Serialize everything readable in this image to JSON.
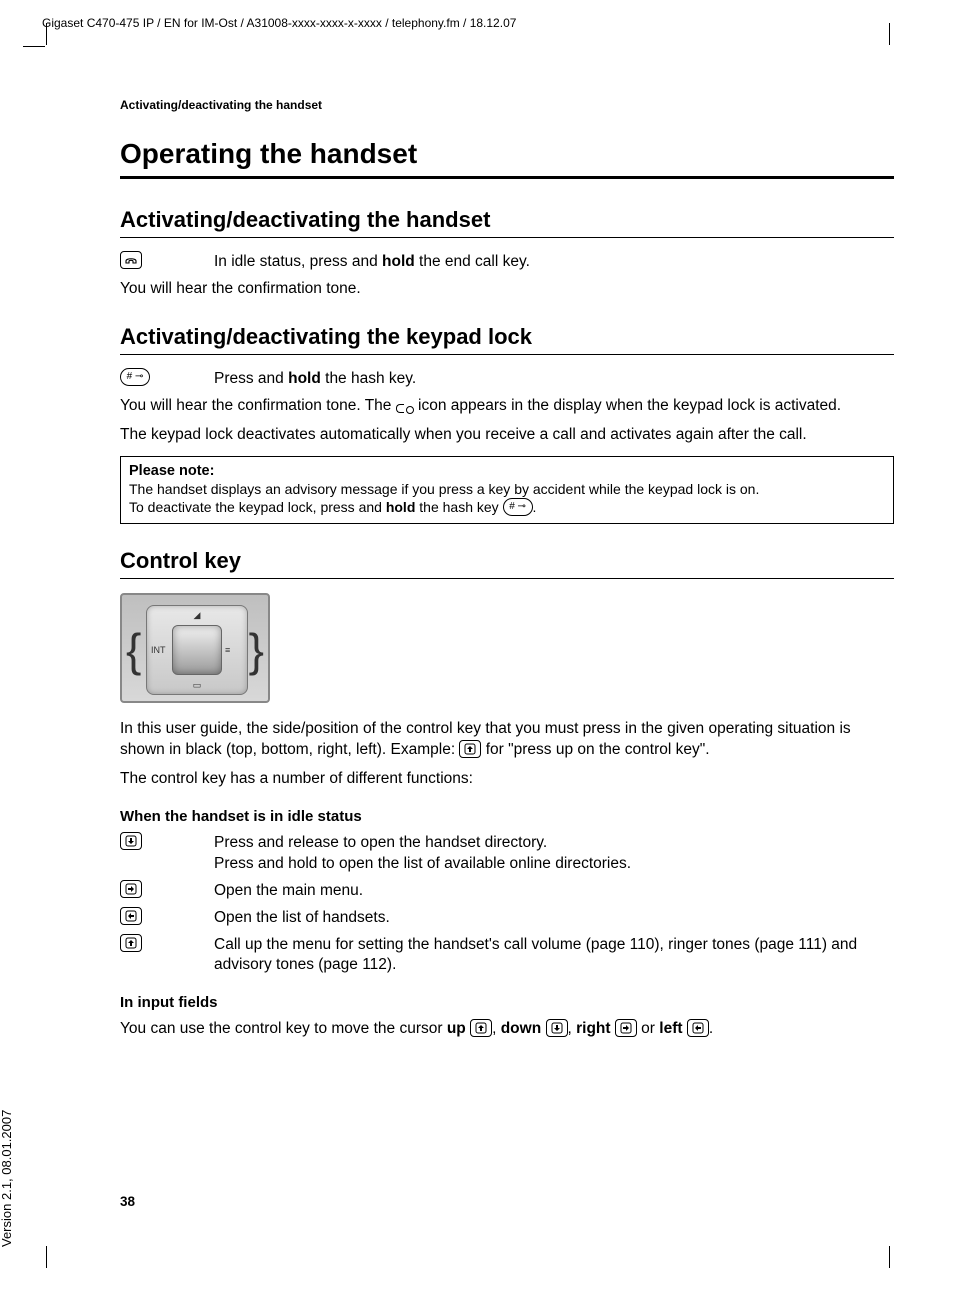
{
  "meta": {
    "header_line": "Gigaset C470-475 IP / EN for IM-Ost / A31008-xxxx-xxxx-x-xxxx / telephony.fm / 18.12.07",
    "version": "Version 2.1, 08.01.2007",
    "page_num": "38"
  },
  "running_head": "Activating/deactivating the handset",
  "h1": "Operating the handset",
  "s1": {
    "title": "Activating/deactivating the handset",
    "row_icon": "end-call-key",
    "row_text_pre": "In idle status, press and ",
    "row_text_bold": "hold",
    "row_text_post": " the end call key.",
    "p1": "You will hear the confirmation tone."
  },
  "s2": {
    "title": "Activating/deactivating the keypad lock",
    "row_icon": "hash-key",
    "row_text_pre": "Press and ",
    "row_text_bold": "hold",
    "row_text_post": " the hash key.",
    "p1_pre": "You will hear the confirmation tone. The ",
    "p1_post": " icon appears in the display when the keypad lock is activated.",
    "p2": "The keypad lock deactivates automatically when you receive a call and activates again after the call.",
    "note_title": "Please note:",
    "note_l1": "The handset displays an advisory message if you press a key by accident while the keypad lock is on.",
    "note_l2_pre": "To deactivate the keypad lock, press and ",
    "note_l2_bold": "hold",
    "note_l2_mid": " the hash key ",
    "note_l2_post": "."
  },
  "s3": {
    "title": "Control key",
    "ck_int": "INT",
    "ck_menu": "≡",
    "p1_pre": "In this user guide, the side/position of the control key that you must press in the given operating situation is shown in black (top, bottom, right, left). Example: ",
    "p1_post": " for \"press up on the control key\".",
    "p2": "The control key has a number of different functions:",
    "idle_title": "When the handset is in idle status",
    "idle_rows": [
      {
        "icon": "nav-down",
        "text": "Press and release to open the handset directory.\nPress and hold to open the list of available online directories."
      },
      {
        "icon": "nav-right",
        "text": "Open the main menu."
      },
      {
        "icon": "nav-left",
        "text": "Open the list of handsets."
      },
      {
        "icon": "nav-up",
        "text": "Call up the menu for setting the handset's call volume (page 110), ringer tones (page 111) and advisory tones (page 112)."
      }
    ],
    "input_title": "In input fields",
    "input_pre": "You can use the control key to move the cursor ",
    "input_up": "up",
    "input_down": "down",
    "input_right": "right",
    "input_left": "left",
    "input_sep": ", ",
    "input_or": " or ",
    "input_end": "."
  }
}
